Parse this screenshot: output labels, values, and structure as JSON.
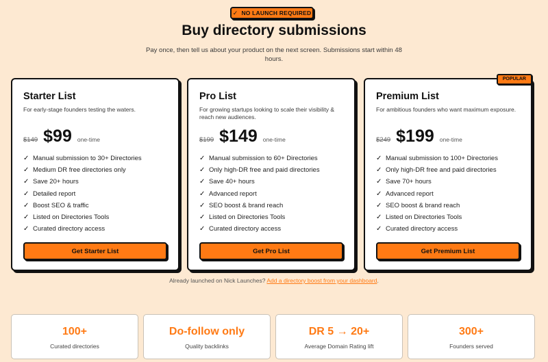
{
  "header": {
    "badge_icon": "check-icon",
    "badge_label": "NO LAUNCH REQUIRED",
    "title": "Buy directory submissions",
    "subtitle": "Pay once, then tell us about your product on the next screen. Submissions start within 48 hours."
  },
  "plans": [
    {
      "name": "Starter List",
      "description": "For early-stage founders testing the waters.",
      "old_price": "$149",
      "price": "$99",
      "period": "one-time",
      "features": [
        "Manual submission to 30+ Directories",
        "Medium DR free directories only",
        "Save 20+ hours",
        "Detailed report",
        "Boost SEO & traffic",
        "Listed on Directories Tools",
        "Curated directory access"
      ],
      "cta": "Get Starter List"
    },
    {
      "name": "Pro List",
      "description": "For growing startups looking to scale their visibility & reach new audiences.",
      "old_price": "$199",
      "price": "$149",
      "period": "one-time",
      "features": [
        "Manual submission to 60+ Directories",
        "Only high-DR free and paid directories",
        "Save 40+ hours",
        "Advanced report",
        "SEO boost & brand reach",
        "Listed on Directories Tools",
        "Curated directory access"
      ],
      "cta": "Get Pro List"
    },
    {
      "name": "Premium List",
      "badge": "POPULAR",
      "description": "For ambitious founders who want maximum exposure.",
      "old_price": "$249",
      "price": "$199",
      "period": "one-time",
      "features": [
        "Manual submission to 100+ Directories",
        "Only high-DR free and paid directories",
        "Save 70+ hours",
        "Advanced report",
        "SEO boost & brand reach",
        "Listed on Directories Tools",
        "Curated directory access"
      ],
      "cta": "Get Premium List"
    }
  ],
  "note": {
    "text": "Already launched on Nick Launches?",
    "link": "Add a directory boost from your dashboard",
    "suffix": "."
  },
  "stats": [
    {
      "value": "100+",
      "label": "Curated directories"
    },
    {
      "value": "Do-follow only",
      "label": "Quality backlinks"
    },
    {
      "value": "DR 5 → 20+",
      "label": "Average Domain Rating lift"
    },
    {
      "value": "300+",
      "label": "Founders served"
    }
  ],
  "colors": {
    "background": "#fde9d2",
    "accent": "#ff7a14",
    "border": "#111111"
  }
}
